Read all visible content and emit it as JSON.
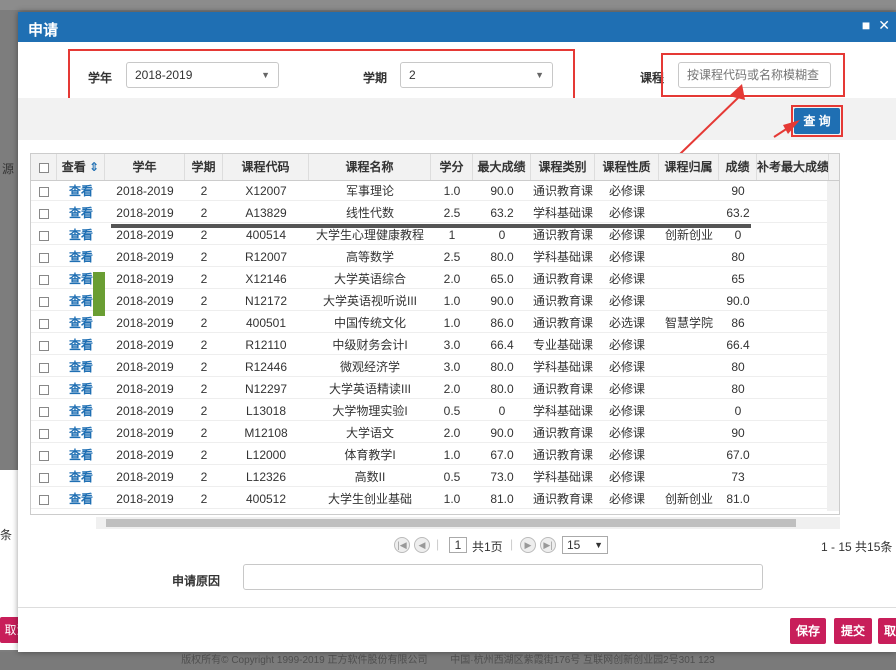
{
  "dialog": {
    "title": "申请"
  },
  "filters": {
    "year_label": "学年",
    "year_value": "2018-2019",
    "term_label": "学期",
    "term_value": "2",
    "course_label": "课程",
    "course_placeholder": "按课程代码或名称模糊查"
  },
  "toolbar": {
    "query_label": "查 询"
  },
  "table": {
    "headers": [
      "查看",
      "学年",
      "学期",
      "课程代码",
      "课程名称",
      "学分",
      "最大成绩",
      "课程类别",
      "课程性质",
      "课程归属",
      "成绩",
      "补考最大成绩"
    ],
    "rows": [
      [
        "查看",
        "2018-2019",
        "2",
        "X12007",
        "军事理论",
        "1.0",
        "90.0",
        "通识教育课",
        "必修课",
        "",
        "90",
        ""
      ],
      [
        "查看",
        "2018-2019",
        "2",
        "A13829",
        "线性代数",
        "2.5",
        "63.2",
        "学科基础课",
        "必修课",
        "",
        "63.2",
        ""
      ],
      [
        "查看",
        "2018-2019",
        "2",
        "400514",
        "大学生心理健康教程",
        "1",
        "0",
        "通识教育课",
        "必修课",
        "创新创业",
        "0",
        ""
      ],
      [
        "查看",
        "2018-2019",
        "2",
        "R12007",
        "高等数学",
        "2.5",
        "80.0",
        "学科基础课",
        "必修课",
        "",
        "80",
        ""
      ],
      [
        "查看",
        "2018-2019",
        "2",
        "X12146",
        "大学英语综合",
        "2.0",
        "65.0",
        "通识教育课",
        "必修课",
        "",
        "65",
        ""
      ],
      [
        "查看",
        "2018-2019",
        "2",
        "N12172",
        "大学英语视听说III",
        "1.0",
        "90.0",
        "通识教育课",
        "必修课",
        "",
        "90.0",
        ""
      ],
      [
        "查看",
        "2018-2019",
        "2",
        "400501",
        "中国传统文化",
        "1.0",
        "86.0",
        "通识教育课",
        "必选课",
        "智慧学院",
        "86",
        ""
      ],
      [
        "查看",
        "2018-2019",
        "2",
        "R12110",
        "中级财务会计I",
        "3.0",
        "66.4",
        "专业基础课",
        "必修课",
        "",
        "66.4",
        ""
      ],
      [
        "查看",
        "2018-2019",
        "2",
        "R12446",
        "微观经济学",
        "3.0",
        "80.0",
        "学科基础课",
        "必修课",
        "",
        "80",
        ""
      ],
      [
        "查看",
        "2018-2019",
        "2",
        "N12297",
        "大学英语精读III",
        "2.0",
        "80.0",
        "通识教育课",
        "必修课",
        "",
        "80",
        ""
      ],
      [
        "查看",
        "2018-2019",
        "2",
        "L13018",
        "大学物理实验I",
        "0.5",
        "0",
        "学科基础课",
        "必修课",
        "",
        "0",
        ""
      ],
      [
        "查看",
        "2018-2019",
        "2",
        "M12108",
        "大学语文",
        "2.0",
        "90.0",
        "通识教育课",
        "必修课",
        "",
        "90",
        ""
      ],
      [
        "查看",
        "2018-2019",
        "2",
        "L12000",
        "体育教学I",
        "1.0",
        "67.0",
        "通识教育课",
        "必修课",
        "",
        "67.0",
        ""
      ],
      [
        "查看",
        "2018-2019",
        "2",
        "L12326",
        "高数II",
        "0.5",
        "73.0",
        "学科基础课",
        "必修课",
        "",
        "73",
        ""
      ],
      [
        "查看",
        "2018-2019",
        "2",
        "400512",
        "大学生创业基础",
        "1.0",
        "81.0",
        "通识教育课",
        "必修课",
        "创新创业",
        "81.0",
        ""
      ]
    ]
  },
  "pager": {
    "page_value": "1",
    "total_pages": "共1页",
    "page_size": "15",
    "range_text": "1 - 15 共15条"
  },
  "form": {
    "reason_label": "申请原因",
    "reason_value": ""
  },
  "actions": {
    "save": "保存",
    "submit": "提交",
    "close": "取"
  },
  "background": {
    "cancel_label": "取消",
    "side_text": "条",
    "footer_copyright": "版权所有© Copyright 1999-2019 正方软件股份有限公司",
    "footer_address": "中国·杭州西湖区紫霞街176号 互联网创新创业园2号301 123"
  },
  "colors": {
    "primary": "#1f6fb3",
    "accent": "#c81e5a",
    "annotation": "#e53935"
  }
}
